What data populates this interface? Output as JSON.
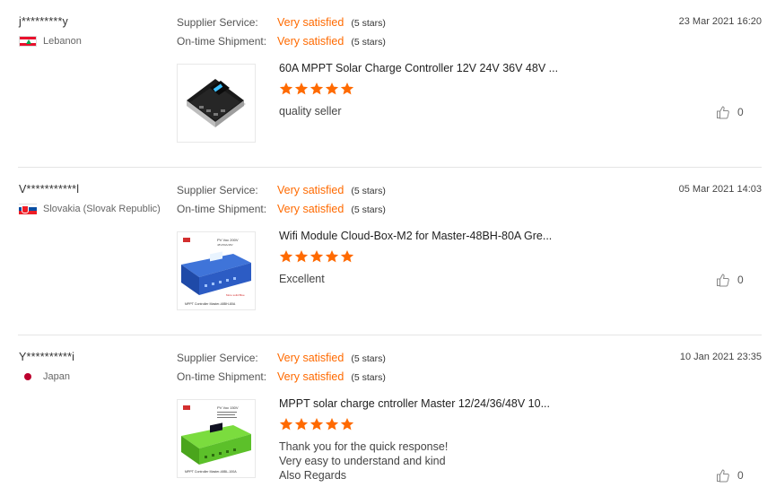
{
  "labels": {
    "supplier_service": "Supplier Service:",
    "ontime_shipment": "On-time Shipment:"
  },
  "colors": {
    "accent": "#ff6a00",
    "divider": "#e5e5e5"
  },
  "reviews": [
    {
      "user": "j*********y",
      "country": "Lebanon",
      "flag_icon": "lebanon-flag-icon",
      "supplier_rating": "Very satisfied",
      "supplier_stars": "(5 stars)",
      "shipment_rating": "Very satisfied",
      "shipment_stars": "(5 stars)",
      "date": "23 Mar 2021 16:20",
      "product": "60A MPPT Solar Charge Controller 12V 24V 36V 48V ...",
      "stars": 5,
      "comment": [
        "quality seller"
      ],
      "likes": "0"
    },
    {
      "user": "V***********l",
      "country": "Slovakia (Slovak Republic)",
      "flag_icon": "slovakia-flag-icon",
      "supplier_rating": "Very satisfied",
      "supplier_stars": "(5 stars)",
      "shipment_rating": "Very satisfied",
      "shipment_stars": "(5 stars)",
      "date": "05 Mar 2021 14:03",
      "product": "Wifi Module Cloud-Box-M2 for Master-48BH-80A Gre...",
      "stars": 5,
      "comment": [
        "Excellent"
      ],
      "likes": "0",
      "thumb_text": {
        "spec": "PV Voc 200V",
        "spec2": "48V/80A/48V",
        "note": "More solid Blue",
        "caption": "MPPT Controller Master-48BH-80A"
      }
    },
    {
      "user": "Y**********i",
      "country": "Japan",
      "flag_icon": "japan-flag-icon",
      "supplier_rating": "Very satisfied",
      "supplier_stars": "(5 stars)",
      "shipment_rating": "Very satisfied",
      "shipment_stars": "(5 stars)",
      "date": "10 Jan 2021 23:35",
      "product": "MPPT solar charge cntroller Master 12/24/36/48V 10...",
      "stars": 5,
      "comment": [
        "Thank you for the quick response!",
        "Very easy to understand and kind",
        "Also Regards"
      ],
      "likes": "0",
      "thumb_text": {
        "spec": "PV Voc 150V",
        "caption": "MPPT Controller Master-48BL-100A"
      }
    }
  ]
}
